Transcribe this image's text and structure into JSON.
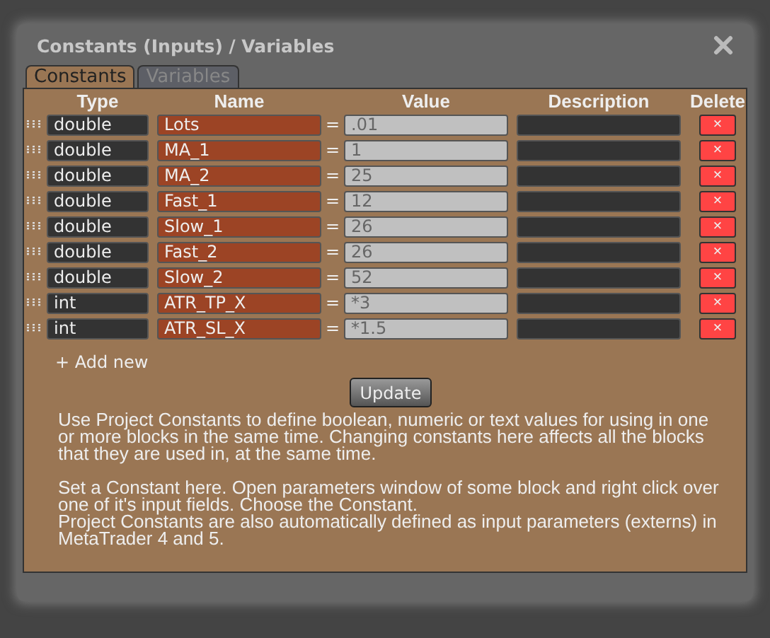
{
  "window": {
    "title": "Constants (Inputs) / Variables"
  },
  "tabs": [
    {
      "label": "Constants",
      "selected": true
    },
    {
      "label": "Variables",
      "selected": false
    }
  ],
  "table": {
    "columns": [
      "Type",
      "Name",
      "Value",
      "Description",
      "Delete"
    ],
    "rows": [
      {
        "type": "double",
        "name": "Lots",
        "equals": "=",
        "value": ".01",
        "delete": "×"
      },
      {
        "type": "double",
        "name": "MA_1",
        "equals": "=",
        "value": "1",
        "delete": "×"
      },
      {
        "type": "double",
        "name": "MA_2",
        "equals": "=",
        "value": "25",
        "delete": "×"
      },
      {
        "type": "double",
        "name": "Fast_1",
        "equals": "=",
        "value": "12",
        "delete": "×"
      },
      {
        "type": "double",
        "name": "Slow_1",
        "equals": "=",
        "value": "26",
        "delete": "×"
      },
      {
        "type": "double",
        "name": "Fast_2",
        "equals": "=",
        "value": "26",
        "delete": "×"
      },
      {
        "type": "double",
        "name": "Slow_2",
        "equals": "=",
        "value": "52",
        "delete": "×"
      },
      {
        "type": "int",
        "name": "ATR_TP_X",
        "equals": "=",
        "value": "*3",
        "delete": "×"
      },
      {
        "type": "int",
        "name": "ATR_SL_X",
        "equals": "=",
        "value": "*1.5",
        "delete": "×"
      }
    ]
  },
  "add_new": "+ Add new",
  "update_button": "Update",
  "help_paragraphs": [
    "Use Project Constants to define boolean, numeric or text values for using in one or more blocks in the same time. Changing constants here affects all the blocks that they are used in, at the same time.",
    "Set a Constant here. Open parameters window of some block and right click over one of it's input fields. Choose the Constant.",
    "Project Constants are also automatically defined as input parameters (externs) in MetaTrader 4 and 5."
  ]
}
